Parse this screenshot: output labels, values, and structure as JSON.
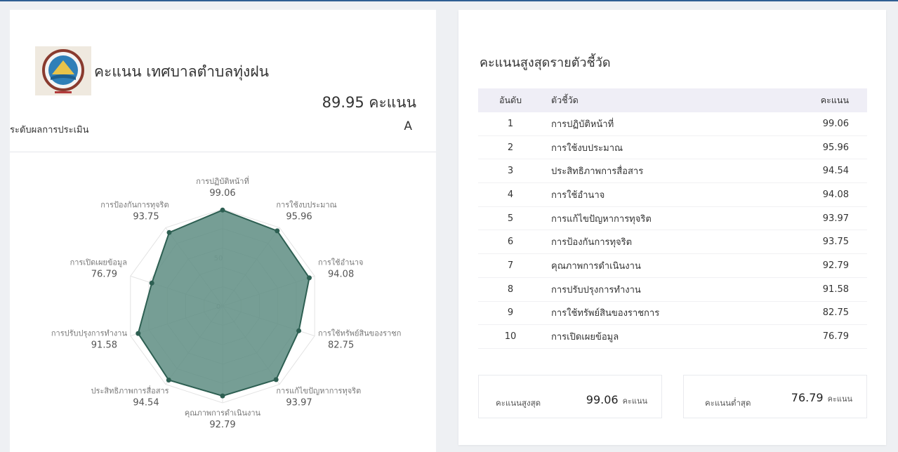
{
  "header": {
    "org_title": "คะแนน เทศบาลตำบลทุ่งฝน",
    "total_score": "89.95 คะแนน",
    "level_label": "ระดับผลการประเมิน",
    "level_value": "A"
  },
  "colors": {
    "accent_border": "#2f5f93",
    "radar_fill": "#5e8d83",
    "radar_stroke": "#2d5f52"
  },
  "icons": {
    "logo": "municipality-seal-logo"
  },
  "chart_data": {
    "type": "radar",
    "rmax": 100,
    "scale_labels": [
      "0",
      "50"
    ],
    "axes": [
      {
        "label": "การปฏิบัติหน้าที่",
        "value": 99.06
      },
      {
        "label": "การใช้งบประมาณ",
        "value": 95.96
      },
      {
        "label": "การใช้อำนาจ",
        "value": 94.08
      },
      {
        "label": "การใช้ทรัพย์สินของราชก",
        "value": 82.75
      },
      {
        "label": "การแก้ไขปัญหาการทุจริต",
        "value": 93.97
      },
      {
        "label": "คุณภาพการดำเนินงาน",
        "value": 92.79
      },
      {
        "label": "ประสิทธิภาพการสื่อสาร",
        "value": 94.54
      },
      {
        "label": "การปรับปรุงการทำงาน",
        "value": 91.58
      },
      {
        "label": "การเปิดเผยข้อมูล",
        "value": 76.79
      },
      {
        "label": "การป้องกันการทุจริต",
        "value": 93.75
      }
    ]
  },
  "ranking": {
    "title": "คะแนนสูงสุดรายตัวชี้วัด",
    "headers": {
      "rank": "อันดับ",
      "indicator": "ตัวชี้วัด",
      "score": "คะแนน"
    },
    "rows": [
      {
        "rank": "1",
        "name": "การปฏิบัติหน้าที่",
        "score": "99.06"
      },
      {
        "rank": "2",
        "name": "การใช้งบประมาณ",
        "score": "95.96"
      },
      {
        "rank": "3",
        "name": "ประสิทธิภาพการสื่อสาร",
        "score": "94.54"
      },
      {
        "rank": "4",
        "name": "การใช้อำนาจ",
        "score": "94.08"
      },
      {
        "rank": "5",
        "name": "การแก้ไขปัญหาการทุจริต",
        "score": "93.97"
      },
      {
        "rank": "6",
        "name": "การป้องกันการทุจริต",
        "score": "93.75"
      },
      {
        "rank": "7",
        "name": "คุณภาพการดำเนินงาน",
        "score": "92.79"
      },
      {
        "rank": "8",
        "name": "การปรับปรุงการทำงาน",
        "score": "91.58"
      },
      {
        "rank": "9",
        "name": "การใช้ทรัพย์สินของราชการ",
        "score": "82.75"
      },
      {
        "rank": "10",
        "name": "การเปิดเผยข้อมูล",
        "score": "76.79"
      }
    ]
  },
  "summary": {
    "max_label": "คะแนนสูงสุด",
    "max_value": "99.06",
    "min_label": "คะแนนต่ำสุด",
    "min_value": "76.79",
    "unit": "คะแนน"
  }
}
